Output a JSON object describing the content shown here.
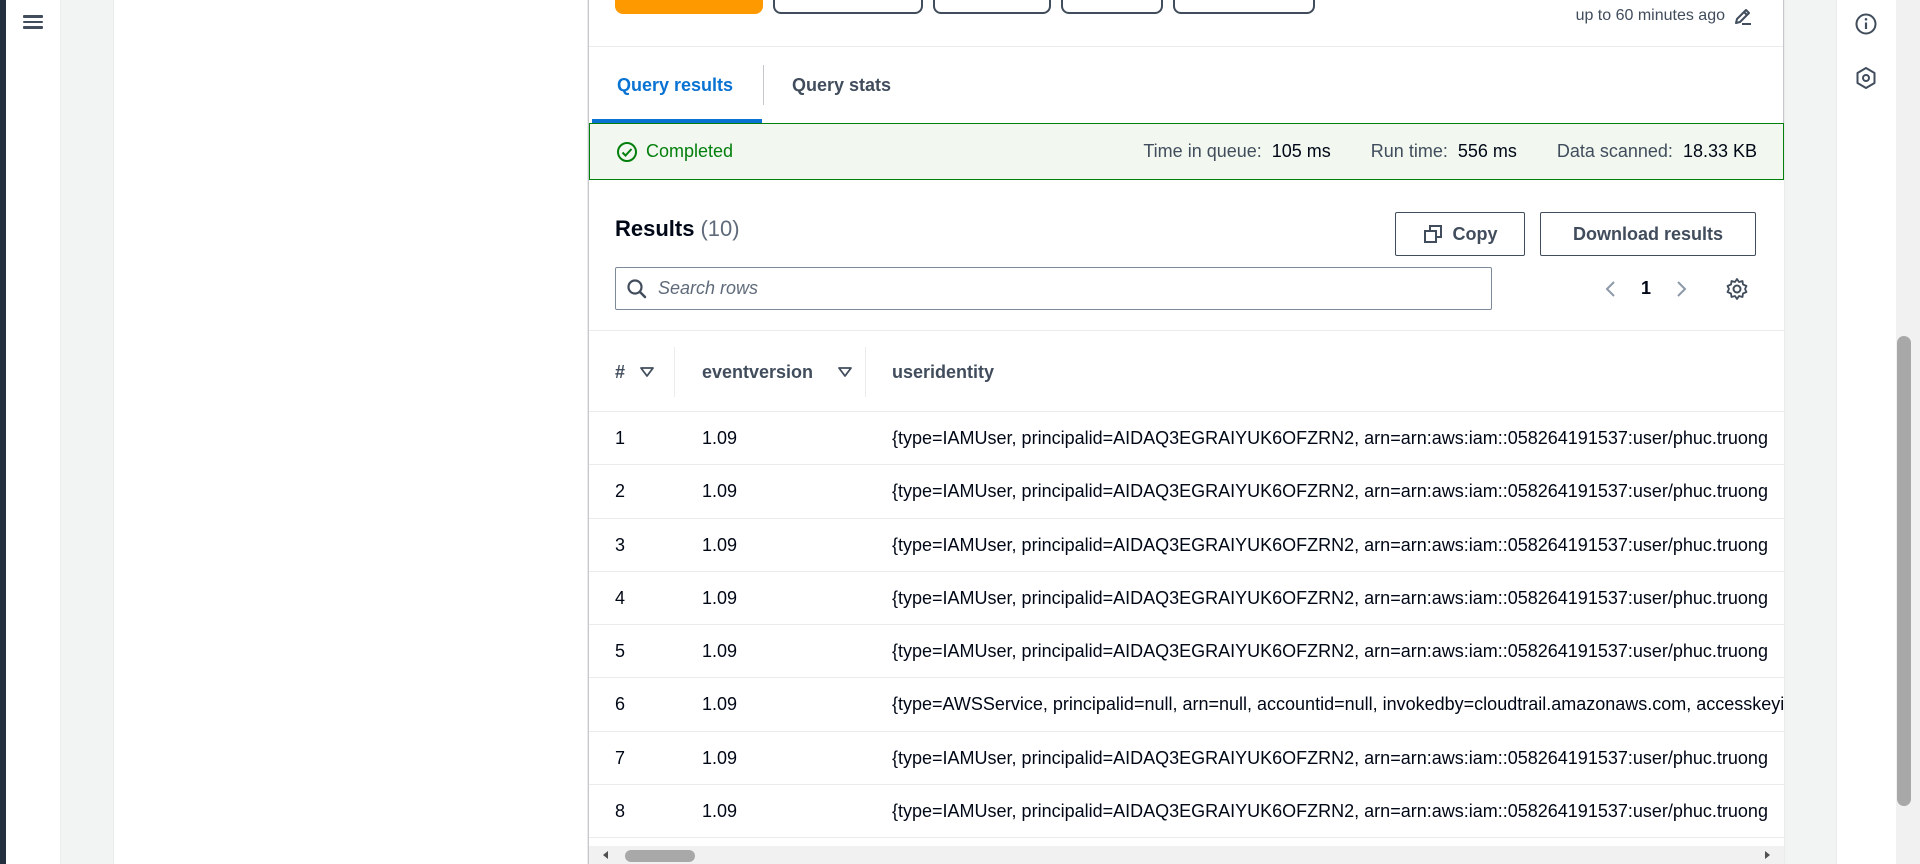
{
  "header": {
    "refresh_note": "up to 60 minutes ago"
  },
  "tabs": [
    {
      "label": "Query results"
    },
    {
      "label": "Query stats"
    }
  ],
  "status": {
    "label": "Completed",
    "queue_label": "Time in queue:",
    "queue_value": "105 ms",
    "run_label": "Run time:",
    "run_value": "556 ms",
    "scanned_label": "Data scanned:",
    "scanned_value": "18.33 KB"
  },
  "results": {
    "title": "Results",
    "count": "(10)",
    "copy_label": "Copy",
    "download_label": "Download results",
    "search_placeholder": "Search rows",
    "page": "1"
  },
  "table": {
    "columns": [
      "#",
      "eventversion",
      "useridentity"
    ],
    "rows": [
      {
        "num": "1",
        "ver": "1.09",
        "uid": "{type=IAMUser, principalid=AIDAQ3EGRAIYUK6OFZRN2, arn=arn:aws:iam::058264191537:user/phuc.truong"
      },
      {
        "num": "2",
        "ver": "1.09",
        "uid": "{type=IAMUser, principalid=AIDAQ3EGRAIYUK6OFZRN2, arn=arn:aws:iam::058264191537:user/phuc.truong"
      },
      {
        "num": "3",
        "ver": "1.09",
        "uid": "{type=IAMUser, principalid=AIDAQ3EGRAIYUK6OFZRN2, arn=arn:aws:iam::058264191537:user/phuc.truong"
      },
      {
        "num": "4",
        "ver": "1.09",
        "uid": "{type=IAMUser, principalid=AIDAQ3EGRAIYUK6OFZRN2, arn=arn:aws:iam::058264191537:user/phuc.truong"
      },
      {
        "num": "5",
        "ver": "1.09",
        "uid": "{type=IAMUser, principalid=AIDAQ3EGRAIYUK6OFZRN2, arn=arn:aws:iam::058264191537:user/phuc.truong"
      },
      {
        "num": "6",
        "ver": "1.09",
        "uid": "{type=AWSService, principalid=null, arn=null, accountid=null, invokedby=cloudtrail.amazonaws.com, accesskeyid"
      },
      {
        "num": "7",
        "ver": "1.09",
        "uid": "{type=IAMUser, principalid=AIDAQ3EGRAIYUK6OFZRN2, arn=arn:aws:iam::058264191537:user/phuc.truong"
      },
      {
        "num": "8",
        "ver": "1.09",
        "uid": "{type=IAMUser, principalid=AIDAQ3EGRAIYUK6OFZRN2, arn=arn:aws:iam::058264191537:user/phuc.truong"
      }
    ]
  },
  "colors": {
    "accent": "#0972d3",
    "success": "#037f0c",
    "primary_button": "#ff9900"
  },
  "icons": {
    "menu": "hamburger-icon",
    "info": "info-icon",
    "extension": "hexagon-icon",
    "status": "check-circle-icon",
    "copy": "copy-icon",
    "search": "search-icon",
    "settings": "gear-icon",
    "edit": "pencil-icon"
  }
}
